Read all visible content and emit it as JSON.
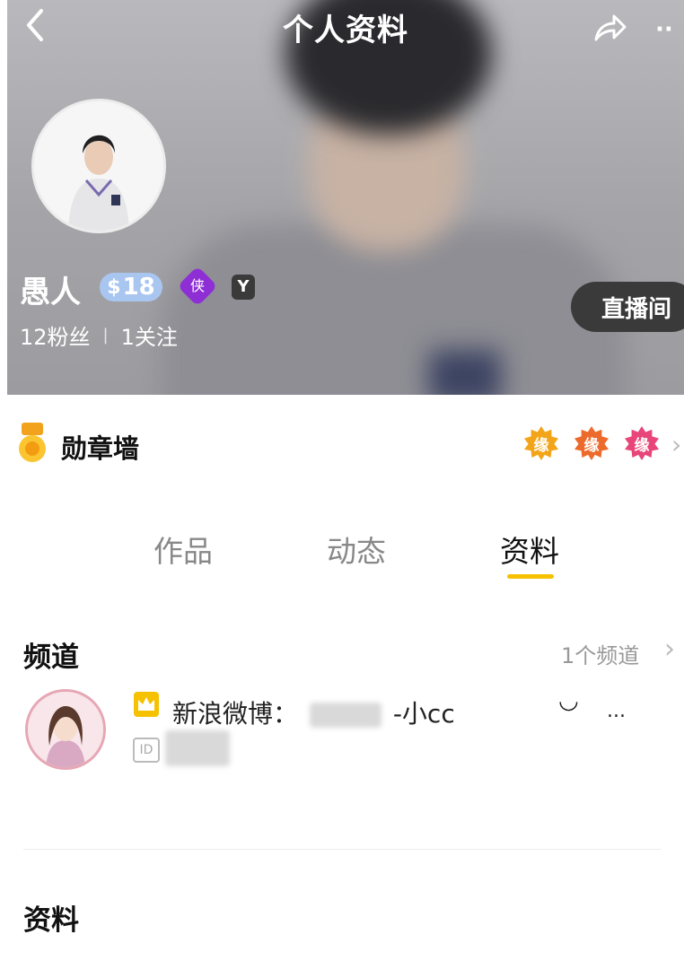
{
  "header": {
    "title": "个人资料",
    "back_icon": "chevron-left-icon",
    "share_icon": "share-icon",
    "more_label": "··"
  },
  "profile": {
    "username": "愚人",
    "level": "18",
    "level_coin": "$",
    "gem_badge_text": "侠",
    "y_badge_text": "Y",
    "followers": "12粉丝",
    "stats_separator": "|",
    "following": "1关注",
    "live_button": "直播间"
  },
  "medals": {
    "title": "勋章墙",
    "badges": [
      {
        "text": "缘",
        "color": "#f2a51a"
      },
      {
        "text": "缘",
        "color": "#ec6a2b"
      },
      {
        "text": "缘",
        "color": "#e8457a"
      }
    ],
    "arrow": "›"
  },
  "tabs": {
    "items": [
      "作品",
      "动态",
      "资料"
    ],
    "active_index": 2,
    "accent": "#f6c200"
  },
  "channel": {
    "section_title": "频道",
    "count": "1个频道",
    "arrow": "›",
    "name_prefix": "新浪微博：",
    "name_suffix": "-小cc",
    "extra": "◡",
    "ellipsis": "...",
    "id_label": "ID"
  },
  "info": {
    "section_title": "资料"
  }
}
